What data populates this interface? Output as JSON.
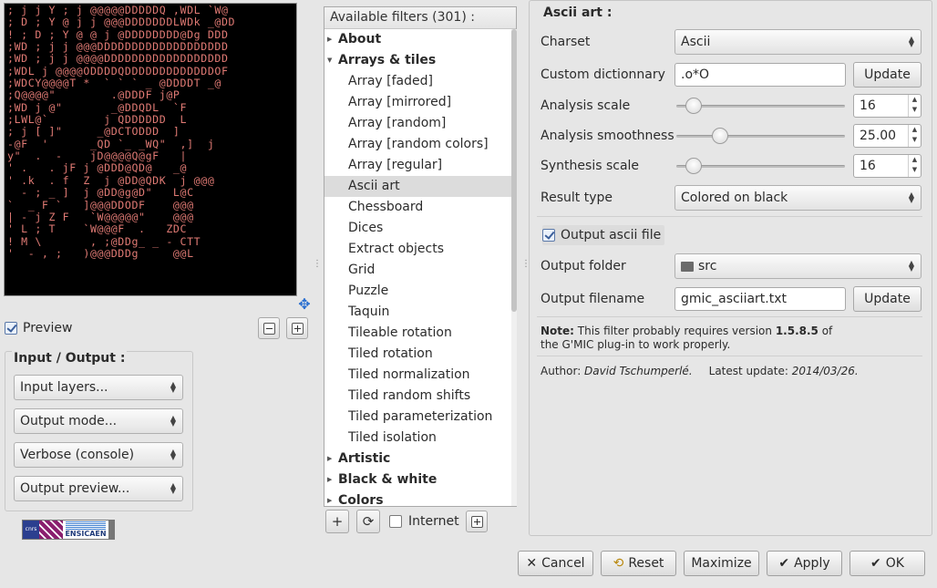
{
  "preview": {
    "label": "Preview",
    "checked": true,
    "ascii_lines": [
      "; j j Y ; j @@@@@DDDDDQ ,WDL `W@",
      "; D ; Y @ j j @@@DDDDDDDLWDk _@DD",
      "! ; D ; Y @ @ j @DDDDDDDD@Dg DDD",
      ";WD ; j j @@@DDDDDDDDDDDDDDDDDDD",
      ";WD ; j j @@@@DDDDDDDDDDDDDDDDDD",
      ";WDL j @@@@ODDDDQDDDDDDDDDDDDDOF",
      ";WDCY@@@@T *  ` ` ` _ @DDDDT _@",
      ";Q@@@@\"        .@DDDF j@P",
      ";WD j @\"       _@DDQDL  `F",
      ";LWL@`        j QDDDDDD  L",
      "; j [ ]\"     _@DCTODDD  ]",
      "-@F  '      _QD `_ _WQ\"  ,]  j",
      "y\"  .  -    jD@@@@Q@gF   |",
      "' .   . jF j @DDD@QD@   _@",
      "' .k  . f  Z  j @DD@QDK  j @@@",
      "  - ; _ ]  j @DD@g@D\"   L@C",
      "`  _ F `   ]@@@DDODF    @@@",
      "| - j Z F   `W@@@@@\"    @@@",
      "' L ; T    `W@@@F  .   ZDC",
      "! M \\       , ;@DDg_ _ - CTT",
      "'  - , ;   )@@@DDDg     @@L"
    ]
  },
  "preview_buttons": {
    "zoom_out": "zoom-out",
    "zoom_in": "zoom-in"
  },
  "io": {
    "title": "Input / Output :",
    "input_layers": "Input layers...",
    "output_mode": "Output mode...",
    "verbose": "Verbose (console)",
    "output_preview": "Output preview..."
  },
  "logo": {
    "text": "ENSICAEN",
    "colors": [
      "#2b3f8f",
      "#8a1f6e",
      "#3f7fd0"
    ]
  },
  "filters": {
    "header": "Available filters (301) :",
    "items": [
      {
        "label": "About",
        "type": "cat",
        "expanded": false
      },
      {
        "label": "Arrays & tiles",
        "type": "cat",
        "expanded": true
      },
      {
        "label": "Array [faded]",
        "type": "leaf"
      },
      {
        "label": "Array [mirrored]",
        "type": "leaf"
      },
      {
        "label": "Array [random]",
        "type": "leaf"
      },
      {
        "label": "Array [random colors]",
        "type": "leaf"
      },
      {
        "label": "Array [regular]",
        "type": "leaf"
      },
      {
        "label": "Ascii art",
        "type": "leaf",
        "selected": true
      },
      {
        "label": "Chessboard",
        "type": "leaf"
      },
      {
        "label": "Dices",
        "type": "leaf"
      },
      {
        "label": "Extract objects",
        "type": "leaf"
      },
      {
        "label": "Grid",
        "type": "leaf"
      },
      {
        "label": "Puzzle",
        "type": "leaf"
      },
      {
        "label": "Taquin",
        "type": "leaf"
      },
      {
        "label": "Tileable rotation",
        "type": "leaf"
      },
      {
        "label": "Tiled rotation",
        "type": "leaf"
      },
      {
        "label": "Tiled normalization",
        "type": "leaf"
      },
      {
        "label": "Tiled random shifts",
        "type": "leaf"
      },
      {
        "label": "Tiled parameterization",
        "type": "leaf"
      },
      {
        "label": "Tiled isolation",
        "type": "leaf"
      },
      {
        "label": "Artistic",
        "type": "cat",
        "expanded": false
      },
      {
        "label": "Black & white",
        "type": "cat",
        "expanded": false
      },
      {
        "label": "Colors",
        "type": "cat",
        "expanded": false
      }
    ],
    "footer": {
      "add": "+",
      "refresh": "⟳",
      "internet_label": "Internet",
      "internet_checked": false
    }
  },
  "params": {
    "title": "Ascii art :",
    "charset": {
      "label": "Charset",
      "value": "Ascii"
    },
    "custom_dict": {
      "label": "Custom dictionnary",
      "value": ".o*O",
      "button": "Update"
    },
    "analysis_scale": {
      "label": "Analysis scale",
      "value": "16",
      "fraction": 0.02
    },
    "analysis_smoothness": {
      "label": "Analysis smoothness",
      "value": "25.00",
      "fraction": 0.2
    },
    "synthesis_scale": {
      "label": "Synthesis scale",
      "value": "16",
      "fraction": 0.02
    },
    "result_type": {
      "label": "Result type",
      "value": "Colored on black"
    },
    "output_ascii": {
      "label": "Output ascii file",
      "checked": true
    },
    "output_folder": {
      "label": "Output folder",
      "value": "src"
    },
    "output_filename": {
      "label": "Output filename",
      "value": "gmic_asciiart.txt",
      "button": "Update"
    },
    "note_prefix": "Note:",
    "note_text": " This filter probably requires version ",
    "note_version": "1.5.8.5",
    "note_suffix": " of",
    "note_line2": "the G'MIC plug-in to work properly.",
    "author_label": "Author: ",
    "author": "David Tschumperlé.",
    "update_label": "Latest update: ",
    "update": "2014/03/26."
  },
  "dialog": {
    "cancel": "Cancel",
    "reset": "Reset",
    "maximize": "Maximize",
    "apply": "Apply",
    "ok": "OK"
  }
}
